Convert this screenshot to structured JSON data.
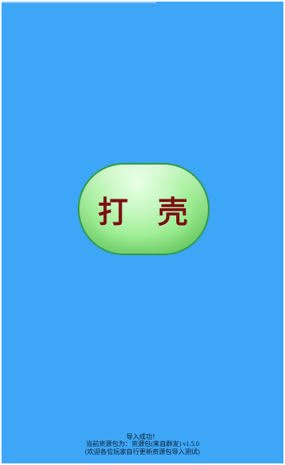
{
  "main": {
    "action_button_label": "打 壳"
  },
  "status": {
    "line1": "导入成功！",
    "line2": "当前资源包为：资源包(来自群友) v1.5.0",
    "line3": "(欢迎各位玩家自行更新资源包导入测试)"
  },
  "colors": {
    "background": "#3ea6f6",
    "button_fill": "#9eee94",
    "button_border": "#2f9b44",
    "button_text": "#7a1010"
  }
}
